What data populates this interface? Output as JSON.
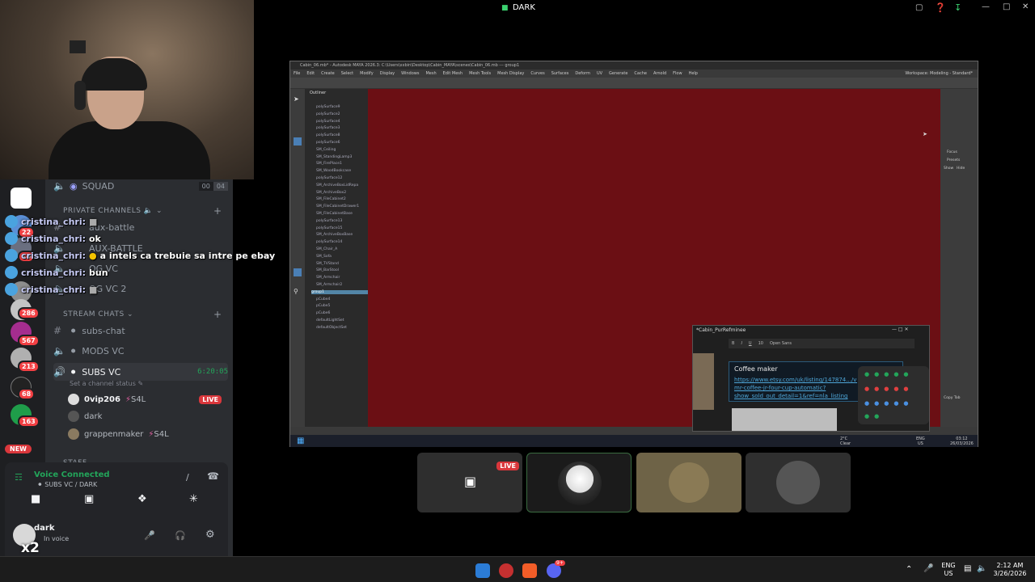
{
  "stream_title": "DARK",
  "discord": {
    "guild_badges": [
      "22",
      "22",
      "10",
      "286",
      "567",
      "213",
      "68",
      "163"
    ],
    "new_badge": "NEW",
    "top_channel": {
      "name": "SQUAD",
      "count_a": "00",
      "count_b": "04"
    },
    "private_category": "PRIVATE CHANNELS",
    "private_channels": [
      "aux-battle",
      "AUX-BATTLE",
      "OG VC",
      "OG VC 2"
    ],
    "stream_category": "STREAM CHATS",
    "stream_channels": [
      "subs-chat",
      "MODS VC",
      "SUBS VC"
    ],
    "active_vc_time": "6:20:05",
    "channel_status_placeholder": "Set a channel status",
    "vc_users": [
      {
        "name": "0vip206",
        "tag": "S4L",
        "badge": "LIVE"
      },
      {
        "name": "dark",
        "tag": "",
        "badge": ""
      },
      {
        "name": "grappenmaker",
        "tag": "S4L",
        "badge": ""
      }
    ],
    "staff_category": "STAFF",
    "voice_status": "Voice Connected",
    "voice_channel": "SUBS VC / DARK",
    "self_name": "dark",
    "self_status": "In voice",
    "multiplier": "x2"
  },
  "chat_overlay": [
    {
      "name": "cristina_chri:",
      "text": ""
    },
    {
      "name": "cristina_chri:",
      "text": "ok"
    },
    {
      "name": "cristina_chri:",
      "text": "a intels ca trebuie sa intre pe ebay"
    },
    {
      "name": "cristina_chri:",
      "text": "bun"
    },
    {
      "name": "cristina_chri:",
      "text": ""
    }
  ],
  "maya": {
    "title": "Cabin_06.mb* - Autodesk MAYA 2026.3: C:\\Users\\xxbin\\Desktop\\Cabin_MAYA\\scenes\\Cabin_06.mb --- group1",
    "menus": [
      "File",
      "Edit",
      "Create",
      "Select",
      "Modify",
      "Display",
      "Windows",
      "Mesh",
      "Edit Mesh",
      "Mesh Tools",
      "Mesh Display",
      "Curves",
      "Surfaces",
      "Deform",
      "UV",
      "Generate",
      "Cache",
      "Arnold",
      "Flow",
      "Help"
    ],
    "workspace": "Workspace: Modeling - Standard*",
    "outliner_title": "Outliner",
    "outliner_items": [
      "polySurface9",
      "polySurface2",
      "polySurface4",
      "polySurface3",
      "polySurface8",
      "polySurface6",
      "SM_Ceiling",
      "SM_StandingLamp3",
      "SM_FirePlace1",
      "SM_WoodBookcase",
      "polySurface12",
      "SM_ArchiveBoxLidRepa",
      "SM_ArchiveBox2",
      "SM_FileCabinet2",
      "SM_FileCabinetDrawer1",
      "SM_FileCabinetBase",
      "polySurface13",
      "polySurface15",
      "SM_ArchiveBoxBase",
      "polySurface14",
      "SM_Chair_A",
      "SM_Sofa",
      "SM_TVStand",
      "SM_BarStool",
      "SM_Armchair",
      "SM_Armchair2",
      "group1",
      "pCube4",
      "pCube5",
      "pCube6",
      "defaultLightSet",
      "defaultObjectSet"
    ],
    "right_panel": [
      "Focus",
      "Presets",
      "Show",
      "Hide",
      "Copy Tab"
    ],
    "popup_title": "*Cabin_PurRefminee",
    "popup_font": "Open Sans",
    "popup_size": "10",
    "note_title": "Coffee maker",
    "note_link": "https://www.etsy.com/uk/listing/147874.../vintage-mr-coffee-jr-four-cup-automatic?show_sold_out_detail=1&ref=nla_listing",
    "tray_temp": "2°C",
    "tray_weather": "Clear",
    "tray_lang": "ENG",
    "tray_region": "US",
    "tray_time": "03:12",
    "tray_date": "26/03/2026"
  },
  "tiles": [
    {
      "label": "LIVE",
      "kind": "screen"
    },
    {
      "label": "",
      "kind": "avatar"
    },
    {
      "label": "",
      "kind": "camera"
    },
    {
      "label": "",
      "kind": "avatar2"
    }
  ],
  "taskbar": {
    "lang": "ENG",
    "region": "US",
    "time": "2:12 AM",
    "date": "3/26/2026",
    "discord_badge": "9+"
  },
  "colors": {
    "viewport_bg": "#6b0f14",
    "discord_green": "#23a55a",
    "live_red": "#da373c"
  }
}
